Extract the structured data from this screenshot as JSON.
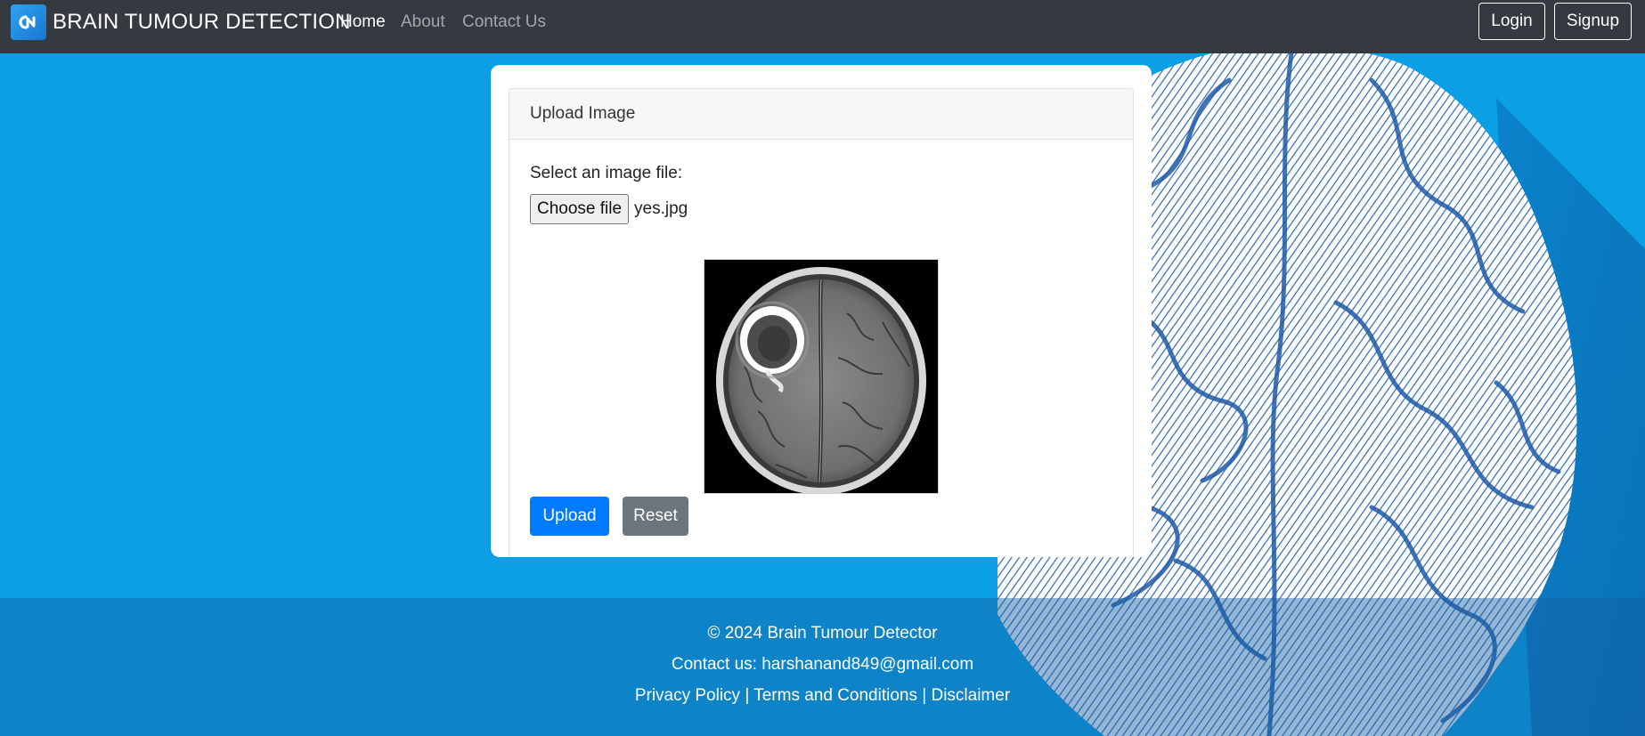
{
  "navbar": {
    "brand": "BRAIN TUMOUR DETECTION",
    "links": [
      {
        "label": "Home",
        "active": true
      },
      {
        "label": "About",
        "active": false
      },
      {
        "label": "Contact Us",
        "active": false
      }
    ],
    "login_label": "Login",
    "signup_label": "Signup"
  },
  "card": {
    "header": "Upload Image",
    "select_label": "Select an image file:",
    "choose_file_label": "Choose file",
    "file_name": "yes.jpg",
    "upload_label": "Upload",
    "reset_label": "Reset"
  },
  "footer": {
    "copyright": "© 2024 Brain Tumour Detector",
    "contact": "Contact us: harshanand849@gmail.com",
    "links": [
      "Privacy Policy",
      "Terms and Conditions",
      "Disclaimer"
    ],
    "separator": "|"
  },
  "colors": {
    "background": "#0ba0e6",
    "navbar": "#343a40",
    "primary": "#007bff",
    "secondary": "#6c757d"
  },
  "icons": [
    "brand-logo-icon",
    "brain-illustration",
    "mri-preview"
  ]
}
